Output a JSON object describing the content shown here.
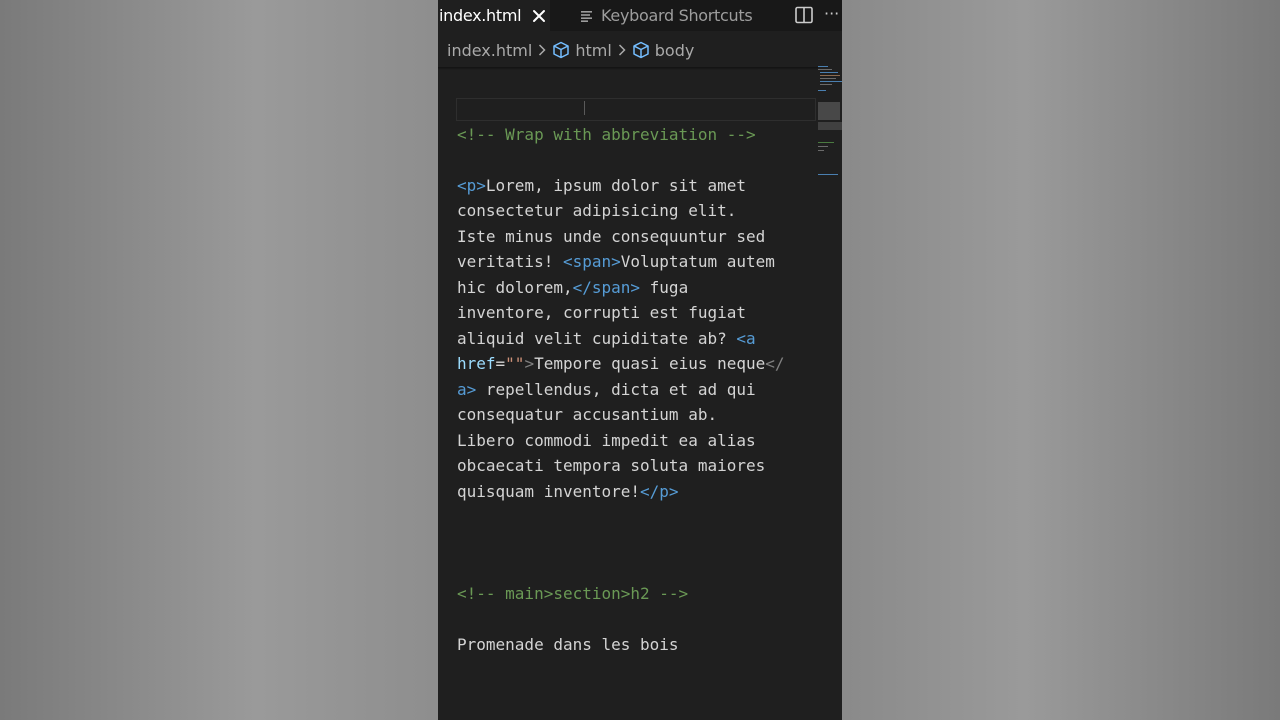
{
  "tabs": {
    "active": {
      "label": "index.html",
      "close_icon": "close-icon"
    },
    "inactive": {
      "label": "Keyboard Shortcuts",
      "icon": "keyboard-shortcuts-icon"
    },
    "actions": {
      "split": "split-editor-icon",
      "more": "···"
    }
  },
  "breadcrumb": {
    "file": "index.html",
    "items": [
      "html",
      "body"
    ]
  },
  "colors": {
    "comment": "#6a9955",
    "tag": "#569cd6",
    "attribute": "#9cdcfe",
    "string": "#ce9178",
    "text": "#d4d4d4",
    "editor_bg": "#1f1f1f"
  },
  "code": {
    "comment1": "<!-- Wrap with abbreviation -->",
    "p_open": "<p>",
    "l1_text": "Lorem, ipsum dolor sit amet",
    "l2_text": "consectetur adipisicing elit.",
    "l3_text": "Iste minus unde consequuntur sed",
    "l4_text": "veritatis! ",
    "span_open": "<span>",
    "l4_text2": "Voluptatum autem",
    "l5_text": "hic dolorem,",
    "span_close": "</span>",
    "l5_text2": " fuga",
    "l6_text": "inventore, corrupti est fugiat",
    "l7_text": "aliquid velit cupiditate ab? ",
    "a_open_start": "<a",
    "href_attr": "href",
    "equals": "=",
    "href_value": "\"\"",
    "a_open_end": ">",
    "l8_text": "Tempore quasi eius neque",
    "a_close_start": "</",
    "a_close_end": "a>",
    "l9_text": " repellendus, dicta et ad qui",
    "l10_text": "consequatur accusantium ab.",
    "l11_text": "Libero commodi impedit ea alias",
    "l12_text": "obcaecati tempora soluta maiores",
    "l13_text": "quisquam inventore!",
    "p_close": "</p>",
    "comment2": "<!-- main>section>h2 -->",
    "last_line": "Promenade dans les bois"
  }
}
